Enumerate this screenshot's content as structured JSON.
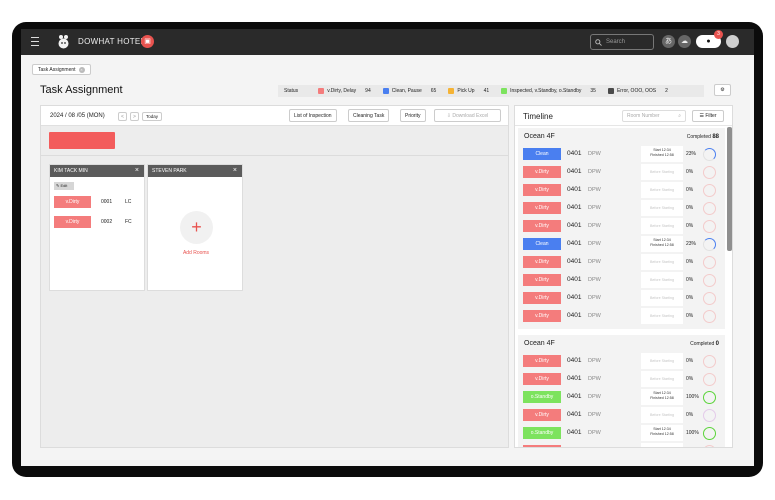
{
  "app": {
    "brand": "DOWHAT HOTEL",
    "search_placeholder": "Search",
    "notif_count": "3"
  },
  "breadcrumb": {
    "label": "Task Assignment"
  },
  "page": {
    "title": "Task Assignment"
  },
  "legend": {
    "label": "Status",
    "items": [
      {
        "label": "v.Dirty, Delay",
        "count": "94",
        "color": "#f47c7c"
      },
      {
        "label": "Clean, Pause",
        "count": "65",
        "color": "#4a7ff0"
      },
      {
        "label": "Pick Up",
        "count": "41",
        "color": "#f5b335"
      },
      {
        "label": "Inspected, v.Standby, o.Standby",
        "count": "35",
        "color": "#7de35e"
      },
      {
        "label": "Error, OOO, OOS",
        "count": "2",
        "color": "#4a4a4a"
      }
    ]
  },
  "toolbar": {
    "date": "2024 / 08 /05 (MON)",
    "today": "Today",
    "prev": "<",
    "next": ">",
    "list_of_inspection": "List of Inspection",
    "cleaning_task": "Cleaning Task",
    "priority": "Priority",
    "download_excel": "Download Excel"
  },
  "columns": [
    {
      "name": "KIM TACK MIN",
      "edit": "Edit",
      "rows": [
        {
          "status": "v.Dirty",
          "room": "0001",
          "type": "LC"
        },
        {
          "status": "v.Dirty",
          "room": "0002",
          "type": "FC"
        }
      ]
    },
    {
      "name": "STEVEN PARK",
      "add_label": "Add Rooms",
      "add_icon": "+"
    }
  ],
  "timeline": {
    "title": "Timeline",
    "room_number_placeholder": "Room Number",
    "filter": "Filter",
    "groups": [
      {
        "name": "Ocean 4F",
        "completed_label": "Completed",
        "completed": "88",
        "rows": [
          {
            "status": "Clean",
            "color": "#4a7ff0",
            "room": "0401",
            "type": "DPW",
            "start": "Start 12:34",
            "finish": "Finished 12:58",
            "pct": "23%",
            "progress": 0.23,
            "ring": "#4a7ff0"
          },
          {
            "status": "v.Dirty",
            "color": "#f47c7c",
            "room": "0401",
            "type": "DPW",
            "muted": "Before Starting",
            "pct": "0%",
            "progress": 0,
            "ring": "#f47c7c"
          },
          {
            "status": "v.Dirty",
            "color": "#f47c7c",
            "room": "0401",
            "type": "DPW",
            "muted": "Before Starting",
            "pct": "0%",
            "progress": 0,
            "ring": "#f47c7c"
          },
          {
            "status": "v.Dirty",
            "color": "#f47c7c",
            "room": "0401",
            "type": "DPW",
            "muted": "Before Starting",
            "pct": "0%",
            "progress": 0,
            "ring": "#f47c7c"
          },
          {
            "status": "v.Dirty",
            "color": "#f47c7c",
            "room": "0401",
            "type": "DPW",
            "muted": "Before Starting",
            "pct": "0%",
            "progress": 0,
            "ring": "#f47c7c"
          },
          {
            "status": "Clean",
            "color": "#4a7ff0",
            "room": "0401",
            "type": "DPW",
            "start": "Start 12:34",
            "finish": "Finished 12:58",
            "pct": "23%",
            "progress": 0.23,
            "ring": "#4a7ff0"
          },
          {
            "status": "v.Dirty",
            "color": "#f47c7c",
            "room": "0401",
            "type": "DPW",
            "muted": "Before Starting",
            "pct": "0%",
            "progress": 0,
            "ring": "#f47c7c"
          },
          {
            "status": "v.Dirty",
            "color": "#f47c7c",
            "room": "0401",
            "type": "DPW",
            "muted": "Before Starting",
            "pct": "0%",
            "progress": 0,
            "ring": "#f47c7c"
          },
          {
            "status": "v.Dirty",
            "color": "#f47c7c",
            "room": "0401",
            "type": "DPW",
            "muted": "Before Starting",
            "pct": "0%",
            "progress": 0,
            "ring": "#f47c7c"
          },
          {
            "status": "v.Dirty",
            "color": "#f47c7c",
            "room": "0401",
            "type": "DPW",
            "muted": "Before Starting",
            "pct": "0%",
            "progress": 0,
            "ring": "#f47c7c"
          }
        ]
      },
      {
        "name": "Ocean 4F",
        "completed_label": "Completed",
        "completed": "0",
        "rows": [
          {
            "status": "v.Dirty",
            "color": "#f47c7c",
            "room": "0401",
            "type": "DPW",
            "muted": "Before Starting",
            "pct": "0%",
            "progress": 0,
            "ring": "#f47c7c"
          },
          {
            "status": "v.Dirty",
            "color": "#f47c7c",
            "room": "0401",
            "type": "DPW",
            "muted": "Before Starting",
            "pct": "0%",
            "progress": 0,
            "ring": "#f47c7c"
          },
          {
            "status": "o.Standby",
            "color": "#7de35e",
            "room": "0401",
            "type": "DPW",
            "start": "Start 12:34",
            "finish": "Finished 12:58",
            "pct": "100%",
            "progress": 1,
            "ring": "#5bd43a"
          },
          {
            "status": "v.Dirty",
            "color": "#f47c7c",
            "room": "0401",
            "type": "DPW",
            "muted": "Before Starting",
            "pct": "0%",
            "progress": 0,
            "ring": "#c77ad8"
          },
          {
            "status": "o.Standby",
            "color": "#7de35e",
            "room": "0401",
            "type": "DPW",
            "start": "Start 12:34",
            "finish": "Finished 12:58",
            "pct": "100%",
            "progress": 1,
            "ring": "#5bd43a"
          },
          {
            "status": "v.Dirty",
            "color": "#f47c7c",
            "room": "0401",
            "type": "DPW",
            "muted": "Before Starting",
            "pct": "0%",
            "progress": 0,
            "ring": "#f47c7c"
          }
        ]
      }
    ]
  }
}
